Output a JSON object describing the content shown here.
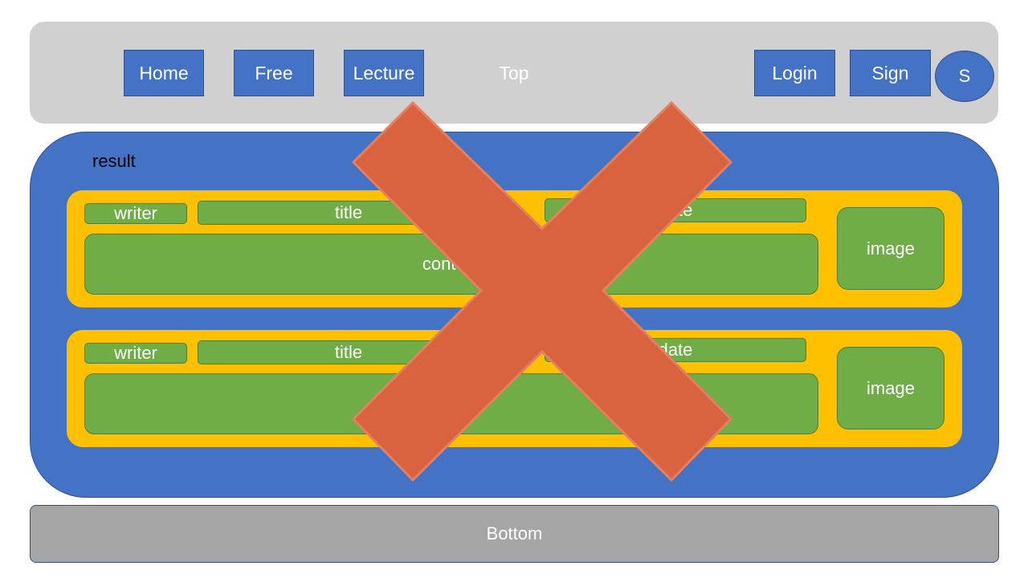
{
  "top": {
    "nav": [
      "Home",
      "Free",
      "Lecture"
    ],
    "label": "Top",
    "login": "Login",
    "sign": "Sign",
    "avatar": "S"
  },
  "result": {
    "label": "result",
    "cards": [
      {
        "writer": "writer",
        "title": "title",
        "date": "date",
        "content": "content",
        "image": "image"
      },
      {
        "writer": "writer",
        "title": "title",
        "date": "date",
        "content": "",
        "image": "image"
      }
    ]
  },
  "bottom": {
    "label": "Bottom"
  },
  "overlay": {
    "icon": "cross-mark-icon",
    "color": "#d9623f"
  },
  "colors": {
    "top_bar": "#d0d0d0",
    "nav": "#4472c4",
    "card": "#ffc000",
    "field": "#70ad47",
    "bottom": "#a5a5a5"
  }
}
